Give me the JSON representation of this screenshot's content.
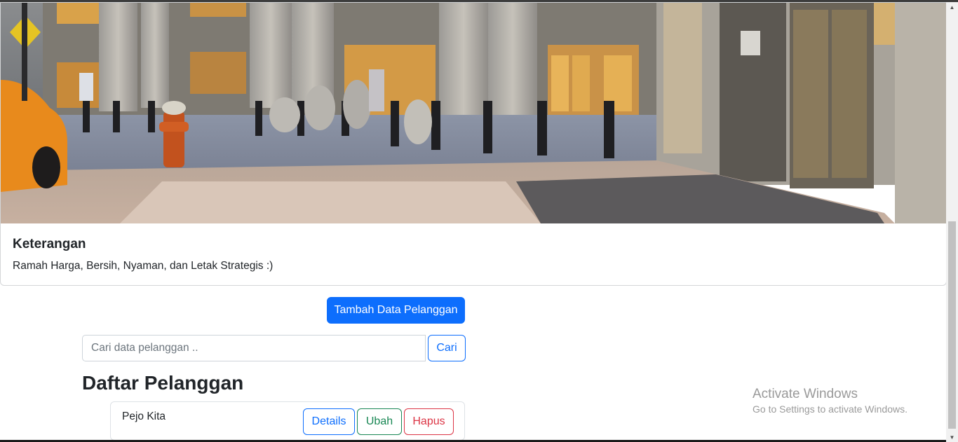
{
  "card": {
    "image_alt": "city-street-storefront",
    "title": "Keterangan",
    "text": "Ramah Harga, Bersih, Nyaman, dan Letak Strategis :)"
  },
  "actions": {
    "add_label": "Tambah Data Pelanggan"
  },
  "search": {
    "placeholder": "Cari data pelanggan ..",
    "value": "",
    "button_label": "Cari"
  },
  "list": {
    "title": "Daftar Pelanggan",
    "items": [
      {
        "name": "Pejo Kita",
        "details_label": "Details",
        "edit_label": "Ubah",
        "delete_label": "Hapus"
      }
    ]
  },
  "watermark": {
    "title": "Activate Windows",
    "subtitle": "Go to Settings to activate Windows."
  },
  "colors": {
    "primary": "#0d6efd",
    "success": "#198754",
    "danger": "#dc3545"
  }
}
